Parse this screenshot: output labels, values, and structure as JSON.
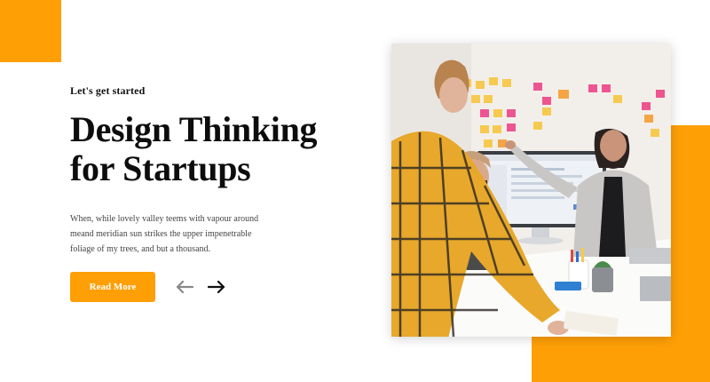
{
  "hero": {
    "eyebrow": "Let's get started",
    "headline_line1": "Design Thinking",
    "headline_line2": "for Startups",
    "description": "When, while lovely valley teems with vapour around meand meridian sun strikes the upper impenetrable foliage of my trees, and but a thousand.",
    "cta_label": "Read More"
  },
  "slider": {
    "prev_icon": "arrow-left-icon",
    "next_icon": "arrow-right-icon"
  },
  "colors": {
    "accent": "#fe9f06",
    "text": "#111111"
  }
}
